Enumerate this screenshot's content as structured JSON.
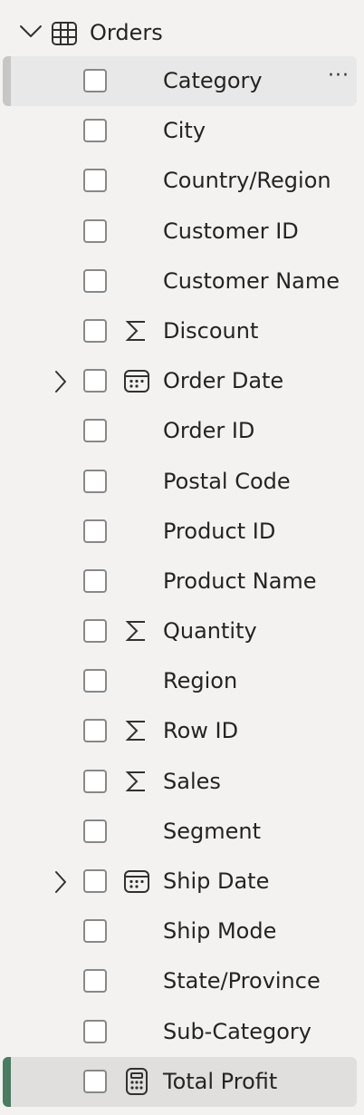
{
  "table": {
    "name": "Orders",
    "icon": "table-icon",
    "expanded": true
  },
  "fields": [
    {
      "label": "Category",
      "type": "text",
      "icon": "",
      "expandable": false,
      "state": "selected",
      "more_label": "···"
    },
    {
      "label": "City",
      "type": "text",
      "icon": "",
      "expandable": false,
      "state": ""
    },
    {
      "label": "Country/Region",
      "type": "text",
      "icon": "",
      "expandable": false,
      "state": ""
    },
    {
      "label": "Customer ID",
      "type": "text",
      "icon": "",
      "expandable": false,
      "state": ""
    },
    {
      "label": "Customer Name",
      "type": "text",
      "icon": "",
      "expandable": false,
      "state": ""
    },
    {
      "label": "Discount",
      "type": "numeric",
      "icon": "sigma-icon",
      "expandable": false,
      "state": ""
    },
    {
      "label": "Order Date",
      "type": "date",
      "icon": "calendar-icon",
      "expandable": true,
      "state": ""
    },
    {
      "label": "Order ID",
      "type": "text",
      "icon": "",
      "expandable": false,
      "state": ""
    },
    {
      "label": "Postal Code",
      "type": "text",
      "icon": "",
      "expandable": false,
      "state": ""
    },
    {
      "label": "Product ID",
      "type": "text",
      "icon": "",
      "expandable": false,
      "state": ""
    },
    {
      "label": "Product Name",
      "type": "text",
      "icon": "",
      "expandable": false,
      "state": ""
    },
    {
      "label": "Quantity",
      "type": "numeric",
      "icon": "sigma-icon",
      "expandable": false,
      "state": ""
    },
    {
      "label": "Region",
      "type": "text",
      "icon": "",
      "expandable": false,
      "state": ""
    },
    {
      "label": "Row ID",
      "type": "numeric",
      "icon": "sigma-icon",
      "expandable": false,
      "state": ""
    },
    {
      "label": "Sales",
      "type": "numeric",
      "icon": "sigma-icon",
      "expandable": false,
      "state": ""
    },
    {
      "label": "Segment",
      "type": "text",
      "icon": "",
      "expandable": false,
      "state": ""
    },
    {
      "label": "Ship Date",
      "type": "date",
      "icon": "calendar-icon",
      "expandable": true,
      "state": ""
    },
    {
      "label": "Ship Mode",
      "type": "text",
      "icon": "",
      "expandable": false,
      "state": ""
    },
    {
      "label": "State/Province",
      "type": "text",
      "icon": "",
      "expandable": false,
      "state": ""
    },
    {
      "label": "Sub-Category",
      "type": "text",
      "icon": "",
      "expandable": false,
      "state": ""
    },
    {
      "label": "Total Profit",
      "type": "measure",
      "icon": "calculator-icon",
      "expandable": false,
      "state": "active"
    }
  ],
  "colors": {
    "background": "#f3f2f1",
    "selected_row": "#e8e8e8",
    "selected_accent": "#c8c6c4",
    "active_row": "#e1dfdd",
    "active_accent": "#4a7b63",
    "checkbox_border": "#8a8886",
    "text": "#252423"
  }
}
